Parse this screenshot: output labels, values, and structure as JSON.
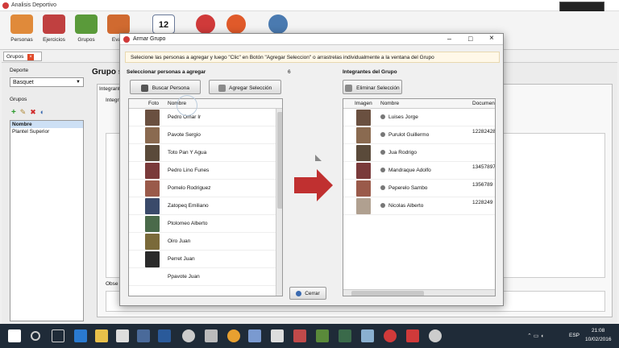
{
  "app": {
    "title": "Analisis Deportivo"
  },
  "toolbar": [
    {
      "label": "Personas",
      "color": "#e08a3a"
    },
    {
      "label": "Ejercicios",
      "color": "#c04040"
    },
    {
      "label": "Grupos",
      "color": "#5a9a3a"
    },
    {
      "label": "Evalu",
      "color": "#d06a30"
    },
    {
      "label": "",
      "color": "#6a7a9a"
    },
    {
      "label": "",
      "color": "#d03a3a"
    },
    {
      "label": "",
      "color": "#e05a2a"
    },
    {
      "label": "",
      "color": "#4a7ab0"
    }
  ],
  "calendar_day": "12",
  "tab": {
    "label": "Grupos"
  },
  "left": {
    "deporte_label": "Deporte",
    "deporte_value": "Basquet",
    "grupos_label": "Grupos",
    "grupos_header": "Nombre",
    "grupos_items": [
      "Plantel Superior"
    ]
  },
  "bg": {
    "title": "Grupo s",
    "tab1": "Integrant",
    "tab2": "Integr",
    "obs": "Obse"
  },
  "dialog": {
    "title": "Armar Grupo",
    "note": "Selecione las personas a agregar y luego \"Clic\" en Botón \"Agregar Seleccion\" o arrastrelas individualmente a la ventana del Grupo",
    "left_header": "Seleccionar personas a agregar",
    "count": "6",
    "buscar_label": "Buscar Persona",
    "agregar_label": "Agregar Selección",
    "col_foto": "Foto",
    "col_nombre": "Nombre",
    "people": [
      {
        "name": "Pedro Omar Ir",
        "color": "#6a5040"
      },
      {
        "name": "Pavote Sergio",
        "color": "#8a6a50"
      },
      {
        "name": "Toto Pan Y Agua",
        "color": "#5a4a3a"
      },
      {
        "name": "Pedro Lino Funes",
        "color": "#7a3a3a"
      },
      {
        "name": "Pomelo Rodriguez",
        "color": "#9a5a4a"
      },
      {
        "name": "Zatopeq Emiliano",
        "color": "#3a4a6a"
      },
      {
        "name": "Ptolomeo Alberto",
        "color": "#4a6a4a"
      },
      {
        "name": "Oiro Juan",
        "color": "#7a6a3a"
      },
      {
        "name": "Perret Juan",
        "color": "#2a2a2a"
      },
      {
        "name": "Ppavote Juan",
        "color": "#f0f0f0"
      }
    ],
    "right_header": "Integrantes del Grupo",
    "eliminar_label": "Eliminar Selección",
    "col_imagen": "Imagen",
    "col_nombre2": "Nombre",
    "col_doc": "Documen",
    "members": [
      {
        "name": "Luises Jorge",
        "doc": "",
        "color": "#6a5040"
      },
      {
        "name": "Purulot Guillermo",
        "doc": "12282428",
        "color": "#8a6a50"
      },
      {
        "name": "Jua Rodrigo",
        "doc": "",
        "color": "#5a4a3a"
      },
      {
        "name": "Mandraque Adolfo",
        "doc": "13457897",
        "color": "#7a3a3a"
      },
      {
        "name": "Peperelo Sambo",
        "doc": "1356789",
        "color": "#9a5a4a"
      },
      {
        "name": "Nicolas Alberto",
        "doc": "1228249",
        "color": "#b0a090"
      }
    ],
    "cerrar_label": "Cerrar"
  },
  "taskbar": {
    "lang": "ESP",
    "time": "21:08",
    "date": "10/02/2016"
  }
}
